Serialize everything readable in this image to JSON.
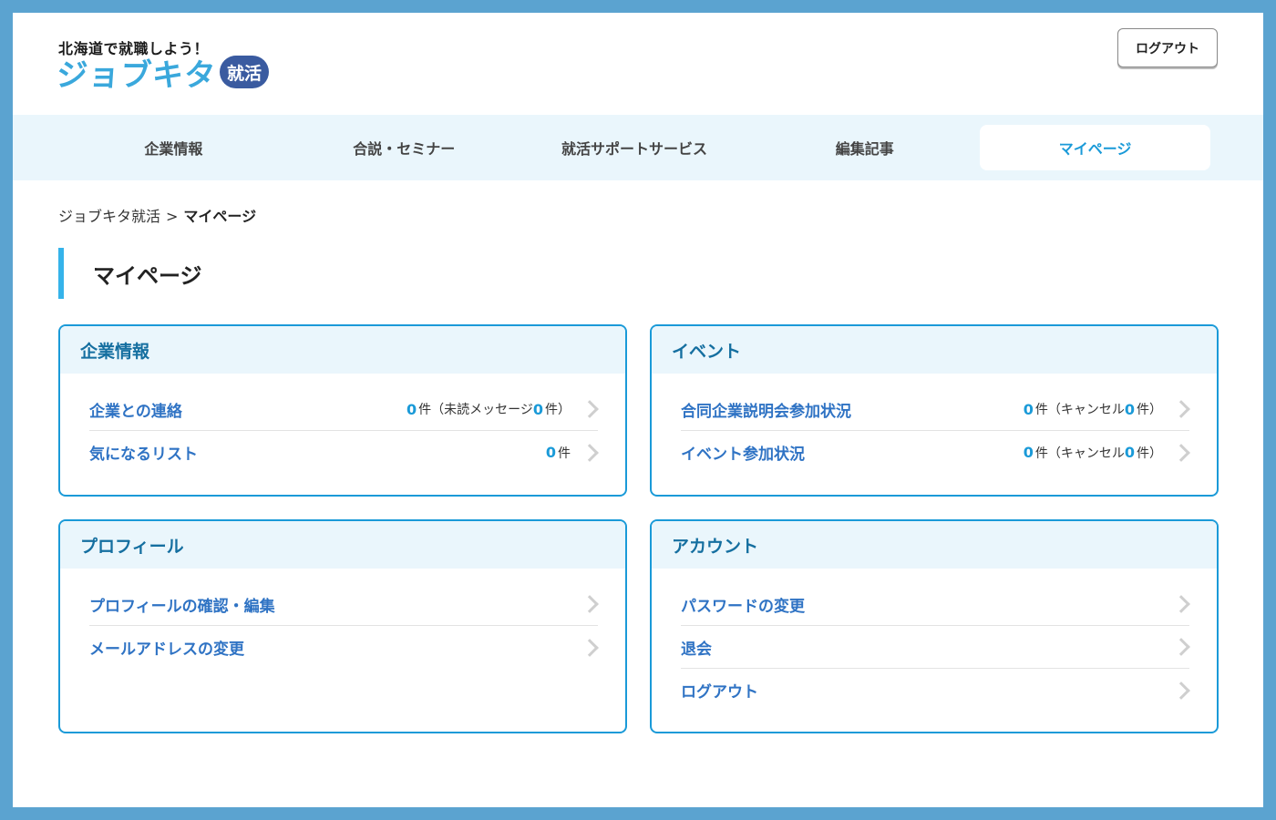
{
  "header": {
    "tagline": "北海道で就職しよう！",
    "logo_text": "ジョブキタ",
    "logo_badge": "就活",
    "logout_label": "ログアウト"
  },
  "nav": {
    "items": [
      {
        "label": "企業情報"
      },
      {
        "label": "合説・セミナー"
      },
      {
        "label": "就活サポートサービス"
      },
      {
        "label": "編集記事"
      },
      {
        "label": "マイページ"
      }
    ],
    "active_index": 4
  },
  "breadcrumb": {
    "home": "ジョブキタ就活",
    "separator": ">",
    "current": "マイページ"
  },
  "page_title": "マイページ",
  "cards": {
    "company": {
      "title": "企業情報",
      "rows": [
        {
          "label": "企業との連絡",
          "count": "0",
          "unit": "件",
          "paren_open": "（未読メッセージ",
          "sub_count": "0",
          "paren_close": "件）"
        },
        {
          "label": "気になるリスト",
          "count": "0",
          "unit": "件"
        }
      ]
    },
    "event": {
      "title": "イベント",
      "rows": [
        {
          "label": "合同企業説明会参加状況",
          "count": "0",
          "unit": "件",
          "paren_open": "（キャンセル",
          "sub_count": "0",
          "paren_close": "件）"
        },
        {
          "label": "イベント参加状況",
          "count": "0",
          "unit": "件",
          "paren_open": "（キャンセル",
          "sub_count": "0",
          "paren_close": "件）"
        }
      ]
    },
    "profile": {
      "title": "プロフィール",
      "rows": [
        {
          "label": "プロフィールの確認・編集"
        },
        {
          "label": "メールアドレスの変更"
        }
      ]
    },
    "account": {
      "title": "アカウント",
      "rows": [
        {
          "label": "パスワードの変更"
        },
        {
          "label": "退会"
        },
        {
          "label": "ログアウト"
        }
      ]
    }
  },
  "colors": {
    "accent": "#1a9ad8",
    "link": "#2f73c4",
    "frame": "#5ba3d0",
    "nav_bg": "#eaf6fc"
  }
}
